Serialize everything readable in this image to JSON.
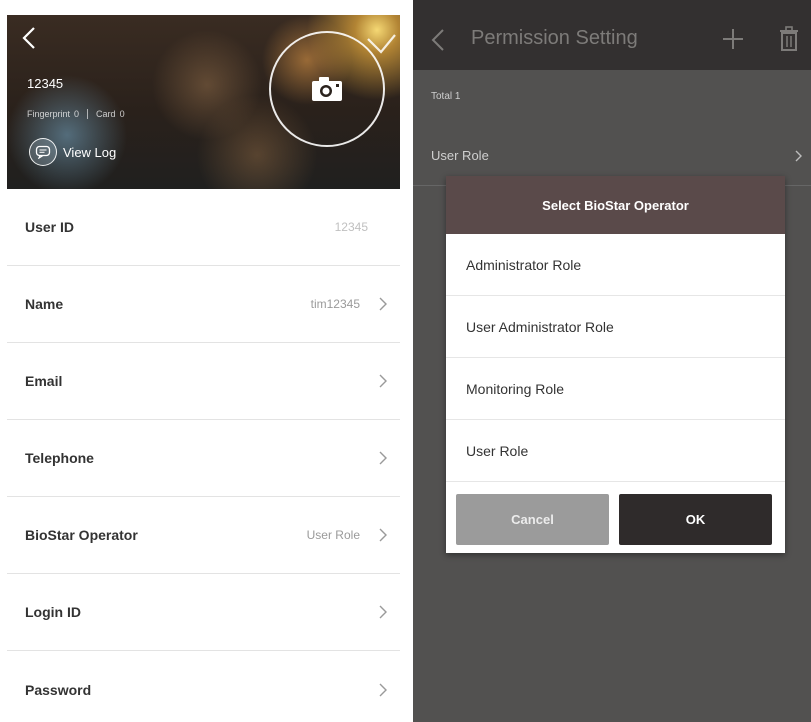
{
  "user_detail": {
    "user_number": "12345",
    "fingerprint_label": "Fingerprint",
    "fingerprint_count": "0",
    "card_label": "Card",
    "card_count": "0",
    "view_log_label": "View Log",
    "rows": [
      {
        "label": "User ID",
        "value": "12345"
      },
      {
        "label": "Name",
        "value": "tim12345"
      },
      {
        "label": "Email",
        "value": ""
      },
      {
        "label": "Telephone",
        "value": ""
      },
      {
        "label": "BioStar Operator",
        "value": "User Role"
      },
      {
        "label": "Login ID",
        "value": ""
      },
      {
        "label": "Password",
        "value": ""
      }
    ]
  },
  "permission_setting": {
    "title": "Permission Setting",
    "total_label": "Total",
    "total_count": "1",
    "list_item": "User Role"
  },
  "dialog": {
    "title": "Select BioStar Operator",
    "options": [
      "Administrator Role",
      "User Administrator Role",
      "Monitoring Role",
      "User Role"
    ],
    "cancel_label": "Cancel",
    "ok_label": "OK"
  },
  "colors": {
    "dialog_header": "#5a4a4a",
    "ok_button": "#2f2b2b",
    "cancel_button": "#9b9b9b",
    "right_background": "#525150"
  }
}
